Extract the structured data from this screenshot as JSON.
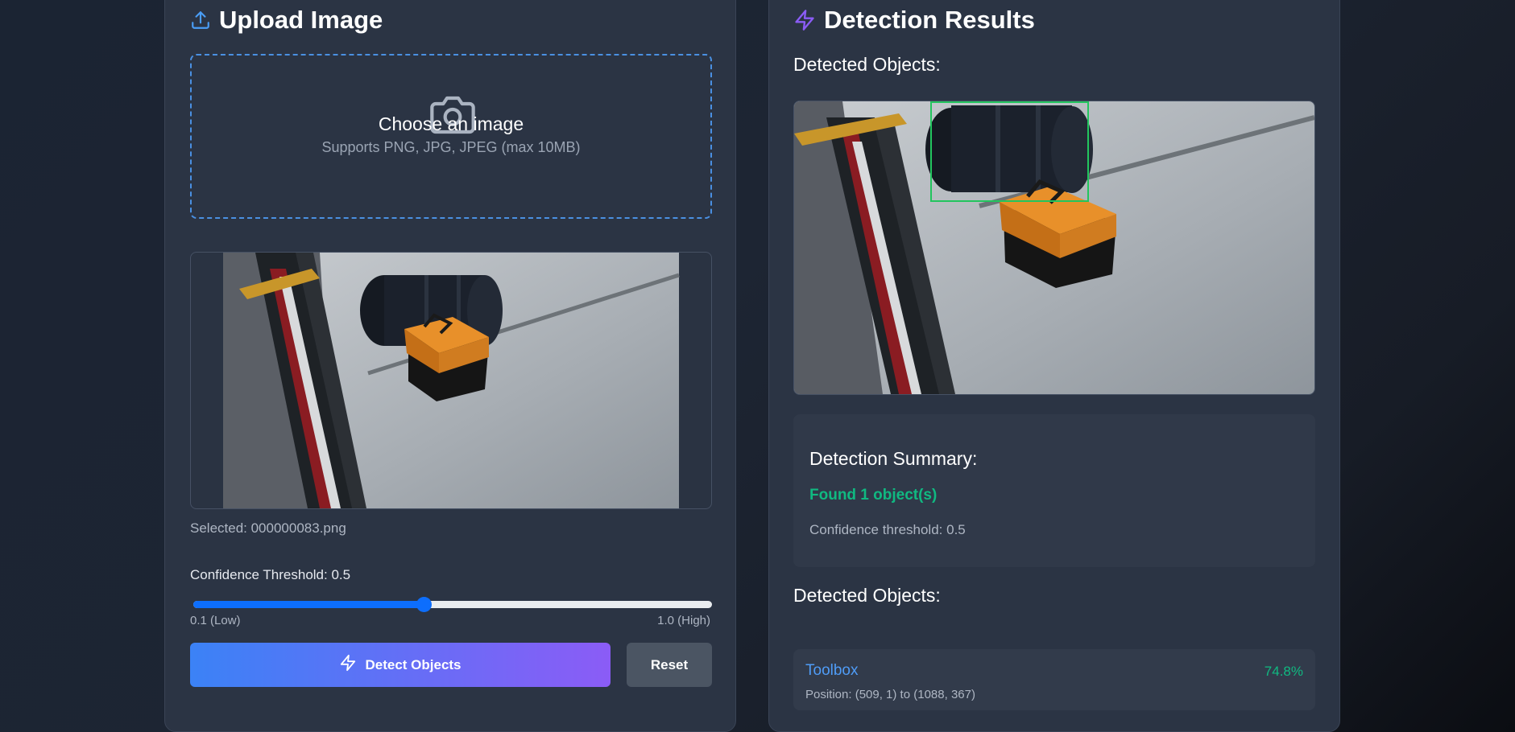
{
  "upload": {
    "title": "Upload Image",
    "dropzone_title": "Choose an image",
    "dropzone_subtitle": "Supports PNG, JPG, JPEG (max 10MB)",
    "selected_file": "Selected: 000000083.png",
    "threshold_label": "Confidence Threshold: 0.5",
    "threshold_value": 0.5,
    "threshold_min": 0.1,
    "threshold_max": 1.0,
    "range_low_label": "0.1 (Low)",
    "range_high_label": "1.0 (High)",
    "detect_label": "Detect Objects",
    "reset_label": "Reset"
  },
  "results": {
    "title": "Detection Results",
    "image_section_label": "Detected Objects:",
    "summary_title": "Detection Summary:",
    "summary_found": "Found 1 object(s)",
    "summary_threshold": "Confidence threshold: 0.5",
    "list_section_label": "Detected Objects:",
    "objects": [
      {
        "name": "Toolbox",
        "confidence": "74.8%",
        "position": "Position: (509, 1) to (1088, 367)"
      }
    ]
  },
  "colors": {
    "accent_blue": "#3b82f6",
    "accent_purple": "#8b5cf6",
    "success_green": "#10b981",
    "bbox_green": "#22c55e"
  },
  "icons": {
    "upload": "upload-icon",
    "detect": "zap-icon",
    "camera": "camera-icon"
  }
}
